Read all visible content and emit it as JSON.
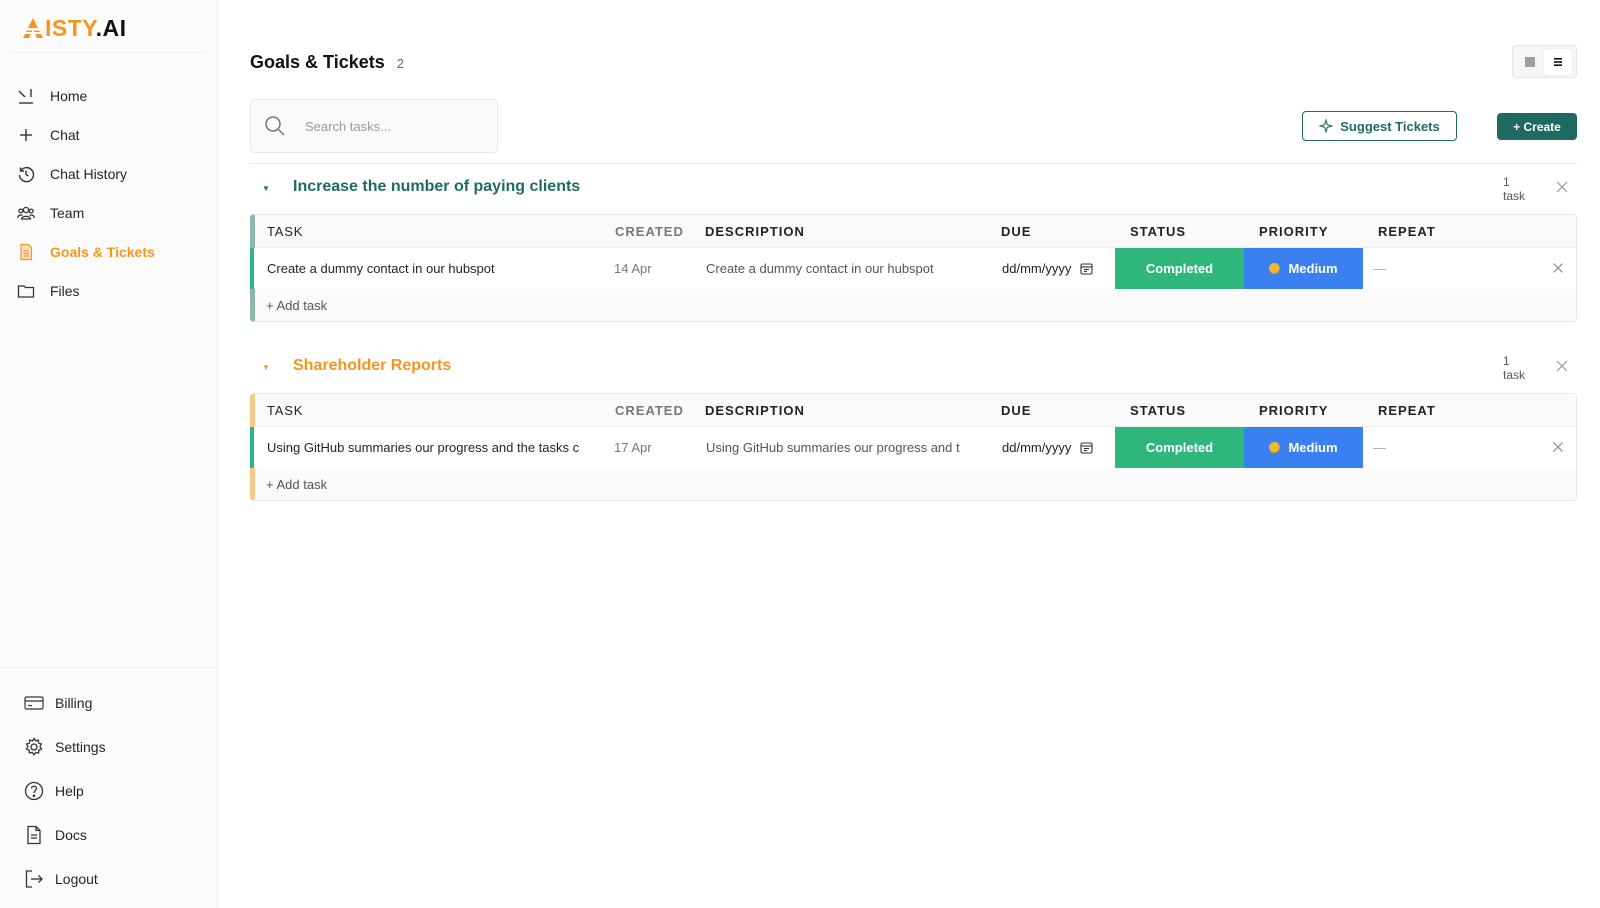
{
  "brand": {
    "name_prefix": "ISTY",
    "name_suffix": ".AI"
  },
  "sidebar": {
    "items": [
      {
        "label": "Home",
        "icon": "home-icon"
      },
      {
        "label": "Chat",
        "icon": "plus-icon"
      },
      {
        "label": "Chat History",
        "icon": "history-icon"
      },
      {
        "label": "Team",
        "icon": "team-icon"
      },
      {
        "label": "Goals & Tickets",
        "icon": "document-icon",
        "active": true
      },
      {
        "label": "Files",
        "icon": "folder-icon"
      }
    ],
    "bottom_items": [
      {
        "label": "Billing",
        "icon": "billing-icon"
      },
      {
        "label": "Settings",
        "icon": "gear-icon"
      },
      {
        "label": "Help",
        "icon": "help-icon"
      },
      {
        "label": "Docs",
        "icon": "doc-icon"
      },
      {
        "label": "Logout",
        "icon": "logout-icon"
      }
    ]
  },
  "header": {
    "title": "Goals & Tickets",
    "count": "2",
    "search_placeholder": "Search tasks...",
    "suggest_label": "Suggest Tickets",
    "create_label": "+ Create"
  },
  "columns": {
    "task": "TASK",
    "created": "CREATED",
    "description": "DESCRIPTION",
    "due": "DUE",
    "status": "STATUS",
    "priority": "PRIORITY",
    "repeat": "REPEAT"
  },
  "groups": [
    {
      "title": "Increase the number of paying clients",
      "count_num": "1",
      "count_unit": "task",
      "color": "#1f6b64",
      "bar_color": "#8fb5b0",
      "add_label": "+ Add task",
      "tasks": [
        {
          "task": "Create a dummy contact in our hubspot",
          "created": "14 Apr",
          "description": "Create a dummy contact in our hubspot",
          "due": "dd/mm/yyyy",
          "status": "Completed",
          "priority": "Medium",
          "repeat": "—"
        }
      ]
    },
    {
      "title": "Shareholder Reports",
      "count_num": "1",
      "count_unit": "task",
      "color": "#f7941d",
      "bar_color": "#f8c98a",
      "add_label": "+ Add task",
      "tasks": [
        {
          "task": "Using GitHub summaries our progress and the tasks c",
          "created": "17 Apr",
          "description": "Using GitHub summaries our progress and t",
          "due": "dd/mm/yyyy",
          "status": "Completed",
          "priority": "Medium",
          "repeat": "—"
        }
      ]
    }
  ],
  "colors": {
    "accent": "#1f6b64",
    "brand_orange": "#f7941d",
    "status_completed": "#2fb67c",
    "priority_medium": "#3a80f0"
  }
}
